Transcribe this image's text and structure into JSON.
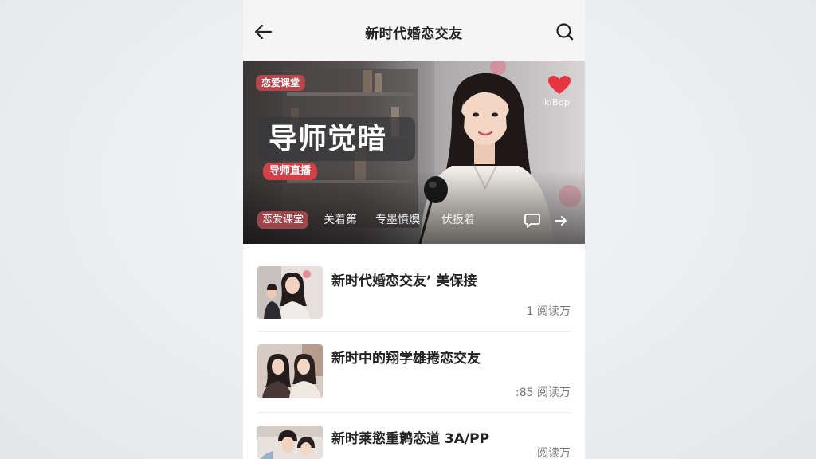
{
  "header": {
    "title": "新时代婚恋交友",
    "back_icon": "arrow-left-icon",
    "search_icon": "search-icon"
  },
  "banner": {
    "tag": "恋爱课堂",
    "heading": "导师觉暗",
    "subtag": "导师直播",
    "brand_label": "kiBop",
    "brand_icon": "heart-icon",
    "bottom_tag": "恋爱课堂",
    "bottom_items": [
      "关着第",
      "专墨憤燠",
      "伏扳着"
    ],
    "chat_icon": "chat-bubble-icon",
    "forward_icon": "arrow-right-icon"
  },
  "articles": [
    {
      "title": "新时代婚恋交友’ 美保接",
      "meta": "1 阅读万"
    },
    {
      "title": "新时中的翔学雄捲恋交友",
      "meta": ":85 阅读万"
    },
    {
      "title": "新时莱慾重鹩恋道 3A/PP",
      "meta": "阅读万"
    }
  ],
  "colors": {
    "accent_red": "#d43f48",
    "tag_red": "#b8474c",
    "background": "#eceef0",
    "title_text": "#222222",
    "meta_text": "#777777"
  }
}
